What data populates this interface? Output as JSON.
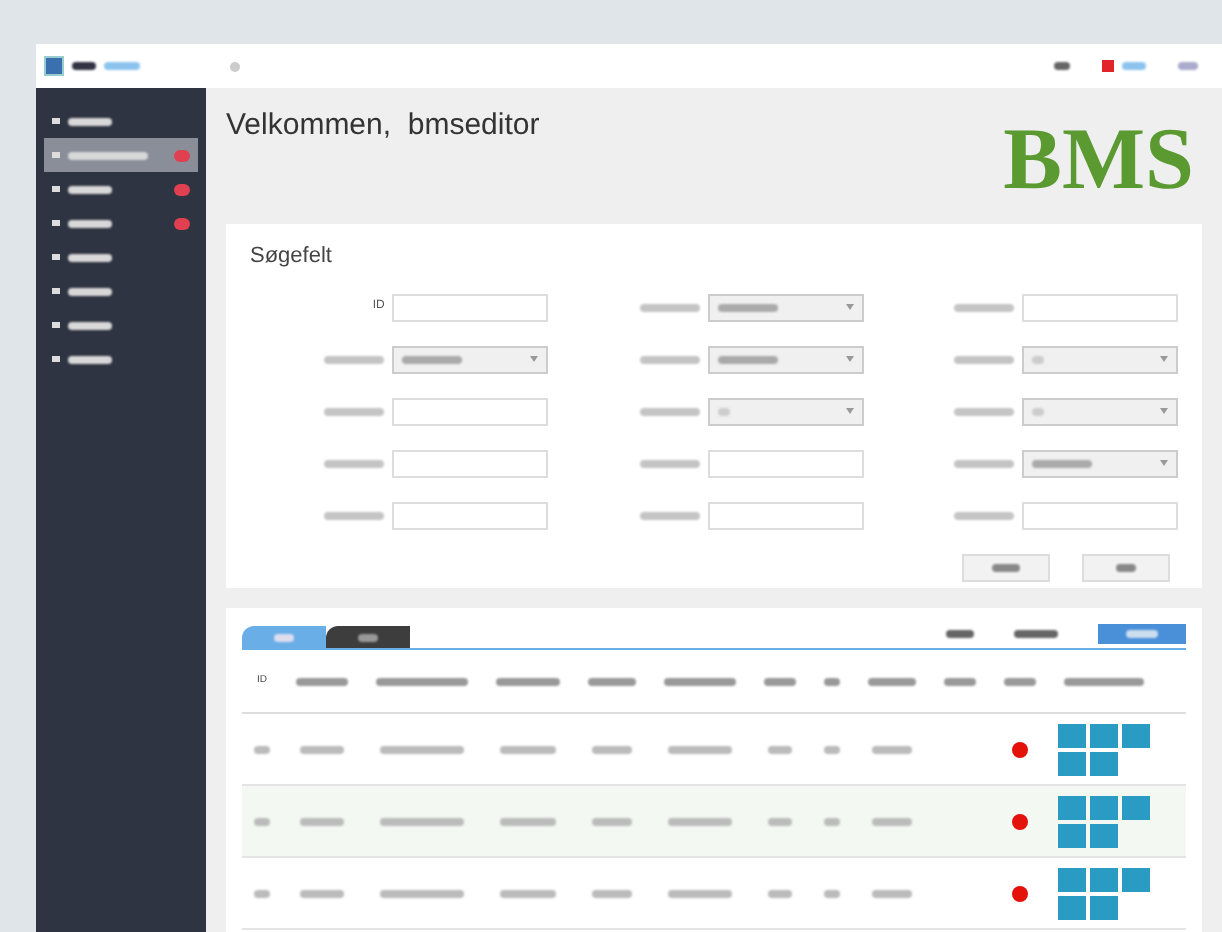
{
  "header": {
    "welcome": "Velkommen,  bmseditor",
    "logo": "BMS"
  },
  "sidebar": {
    "items": [
      {
        "selected": false,
        "badge": false
      },
      {
        "selected": true,
        "badge": true
      },
      {
        "selected": false,
        "badge": true
      },
      {
        "selected": false,
        "badge": true
      },
      {
        "selected": false,
        "badge": false
      },
      {
        "selected": false,
        "badge": false
      },
      {
        "selected": false,
        "badge": false
      },
      {
        "selected": false,
        "badge": false
      }
    ]
  },
  "search": {
    "title": "Søgefelt",
    "fields": [
      {
        "label": "ID",
        "kind": "input"
      },
      {
        "kind": "select",
        "filled": true
      },
      {
        "kind": "input"
      },
      {
        "kind": "select",
        "filled": true
      },
      {
        "kind": "select",
        "filled": true
      },
      {
        "kind": "select",
        "filled": false
      },
      {
        "kind": "input"
      },
      {
        "kind": "select",
        "filled": false
      },
      {
        "kind": "select",
        "filled": false
      },
      {
        "kind": "input"
      },
      {
        "kind": "input"
      },
      {
        "kind": "select",
        "filled": true
      },
      {
        "kind": "input"
      },
      {
        "kind": "input"
      },
      {
        "kind": "input"
      }
    ]
  },
  "table": {
    "tabs": [
      {
        "selected": true
      },
      {
        "selected": false
      }
    ],
    "first_column": "ID",
    "rows": [
      {
        "color": "#e3120b"
      },
      {
        "color": "#e3120b"
      },
      {
        "color": "#e3120b"
      }
    ]
  }
}
